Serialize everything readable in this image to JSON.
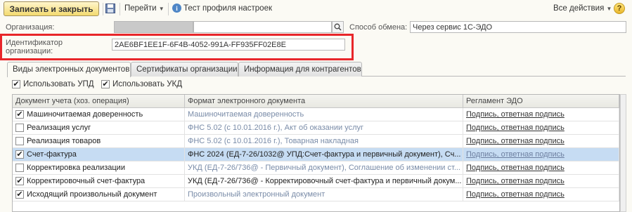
{
  "toolbar": {
    "save_close_label": "Записать и закрыть",
    "goto_label": "Перейти",
    "test_label": "Тест профиля настроек",
    "all_actions_label": "Все действия",
    "help_label": "?"
  },
  "form": {
    "org_label": "Организация:",
    "org_value": "",
    "exchange_label": "Способ обмена:",
    "exchange_value": "Через сервис 1С-ЭДО",
    "id_label_line1": "Идентификатор",
    "id_label_line2": "организации:",
    "id_value": "2AE6BF1EE1F-6F4B-4052-991A-FF935FF02E8E"
  },
  "tabs": [
    {
      "label": "Виды электронных документов"
    },
    {
      "label": "Сертификаты организации"
    },
    {
      "label": "Информация для контрагентов"
    }
  ],
  "options": {
    "upd_label": "Использовать УПД",
    "upd_checked": true,
    "ukd_label": "Использовать УКД",
    "ukd_checked": true
  },
  "table": {
    "columns": [
      "Документ учета (хоз. операция)",
      "Формат электронного документа",
      "Регламент ЭДО"
    ],
    "rows": [
      {
        "checked": true,
        "doc": "Машиночитаемая доверенность",
        "format": "Машиночитаемая доверенность",
        "format_style": "muted",
        "rule": "Подпись, ответная подпись",
        "selected": false
      },
      {
        "checked": false,
        "doc": "Реализация услуг",
        "format": "ФНС 5.02 (с 10.01.2016 г.), Акт об оказании услуг",
        "format_style": "muted",
        "rule": "Подпись, ответная подпись",
        "selected": false
      },
      {
        "checked": false,
        "doc": "Реализация товаров",
        "format": "ФНС 5.02 (с 10.01.2016 г.), Товарная накладная",
        "format_style": "muted",
        "rule": "Подпись, ответная подпись",
        "selected": false
      },
      {
        "checked": true,
        "doc": "Счет-фактура",
        "format": "ФНС 2024 (ЕД-7-26/1032@ УПД:Счет-фактура и первичный документ), Сч...",
        "format_style": "dark",
        "rule": "Подпись, ответная подпись",
        "selected": true
      },
      {
        "checked": false,
        "doc": "Корректировка реализации",
        "format": "УКД (ЕД-7-26/736@ - Первичный документ), Соглашение об изменении ст...",
        "format_style": "muted",
        "rule": "Подпись, ответная подпись",
        "selected": false
      },
      {
        "checked": true,
        "doc": "Корректировочный счет-фактура",
        "format": "УКД (ЕД-7-26/736@ - Корректировочный счет-фактура и первичный докум...",
        "format_style": "dark",
        "rule": "Подпись, ответная подпись",
        "selected": false
      },
      {
        "checked": true,
        "doc": "Исходящий произвольный документ",
        "format": "Произвольный электронный документ",
        "format_style": "muted",
        "rule": "Подпись, ответная подпись",
        "selected": false
      }
    ]
  },
  "colors": {
    "highlight": "#e8262a",
    "selection": "#c6dcf3",
    "button": "#f3da6f"
  },
  "icons": [
    "save-icon",
    "info-icon",
    "help-icon",
    "search-icon",
    "check-icon"
  ]
}
